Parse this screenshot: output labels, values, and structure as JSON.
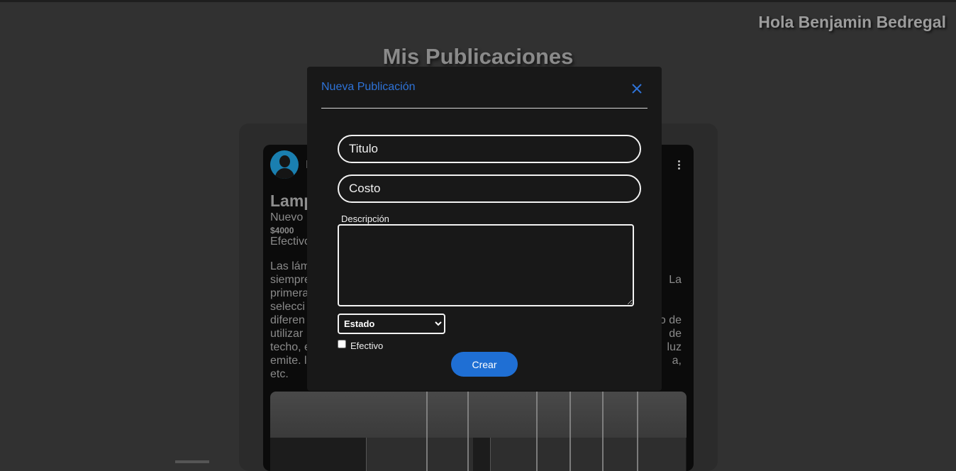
{
  "header": {
    "greeting": "Hola Benjamin Bedregal"
  },
  "page": {
    "title": "Mis Publicaciones"
  },
  "post": {
    "author_initial": "I",
    "title": "Lamp",
    "condition": "Nuevo",
    "price": "$4000",
    "payment": "Efectivo",
    "description_lines": [
      "Las lám",
      "siempre",
      "primera",
      "selecci",
      "diferen",
      "utilizar",
      "techo, e",
      "emite. l",
      "etc."
    ],
    "description_right_lines": [
      "La",
      "o de",
      "de",
      "luz",
      "a,"
    ]
  },
  "modal": {
    "title": "Nueva Publicación",
    "titulo_placeholder": "Titulo",
    "costo_placeholder": "Costo",
    "description_label": "Descripción",
    "estado_selected": "Estado",
    "efectivo_label": "Efectivo",
    "create_button": "Crear"
  },
  "colors": {
    "accent": "#1f6fd4",
    "modal_bg": "#181818",
    "page_bg": "#313131"
  },
  "icons": {
    "close": "close-icon",
    "menu": "kebab-menu-icon",
    "avatar": "user-avatar-icon"
  }
}
